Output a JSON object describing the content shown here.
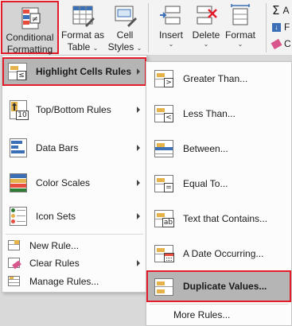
{
  "ribbon": {
    "conditional_formatting": {
      "line1": "Conditional",
      "line2": "Formatting"
    },
    "format_as_table": {
      "line1": "Format as",
      "line2": "Table"
    },
    "cell_styles": {
      "line1": "Cell",
      "line2": "Styles"
    },
    "insert": {
      "line1": "Insert"
    },
    "delete": {
      "line1": "Delete"
    },
    "format": {
      "line1": "Format"
    },
    "editing": {
      "sum_label": "A",
      "fill_label": "F",
      "clear_label": "C"
    }
  },
  "main_menu": {
    "items": [
      {
        "label": "Highlight Cells Rules",
        "icon": "highlight-cells-rules-icon",
        "has_submenu": true
      },
      {
        "label": "Top/Bottom Rules",
        "icon": "top-bottom-rules-icon",
        "has_submenu": true
      },
      {
        "label": "Data Bars",
        "icon": "data-bars-icon",
        "has_submenu": true
      },
      {
        "label": "Color Scales",
        "icon": "color-scales-icon",
        "has_submenu": true
      },
      {
        "label": "Icon Sets",
        "icon": "icon-sets-icon",
        "has_submenu": true
      }
    ],
    "commands": [
      {
        "label": "New Rule...",
        "icon": "new-rule-icon"
      },
      {
        "label": "Clear Rules",
        "icon": "clear-rules-icon",
        "has_submenu": true
      },
      {
        "label": "Manage Rules...",
        "icon": "manage-rules-icon"
      }
    ]
  },
  "sub_menu": {
    "items": [
      {
        "label": "Greater Than...",
        "icon": "greater-than-icon",
        "badge": ">"
      },
      {
        "label": "Less Than...",
        "icon": "less-than-icon",
        "badge": "<"
      },
      {
        "label": "Between...",
        "icon": "between-icon"
      },
      {
        "label": "Equal To...",
        "icon": "equal-to-icon",
        "badge": "="
      },
      {
        "label": "Text that Contains...",
        "icon": "text-contains-icon",
        "badge": "ab"
      },
      {
        "label": "A Date Occurring...",
        "icon": "date-occurring-icon"
      },
      {
        "label": "Duplicate Values...",
        "icon": "duplicate-values-icon"
      }
    ],
    "more_rules": "More Rules..."
  },
  "colors": {
    "highlight_outline": "#e21c2a",
    "hover_background": "#b5b5b5",
    "cell_highlight": "#e6b34a",
    "ribbon_background": "#f3f3f3"
  }
}
